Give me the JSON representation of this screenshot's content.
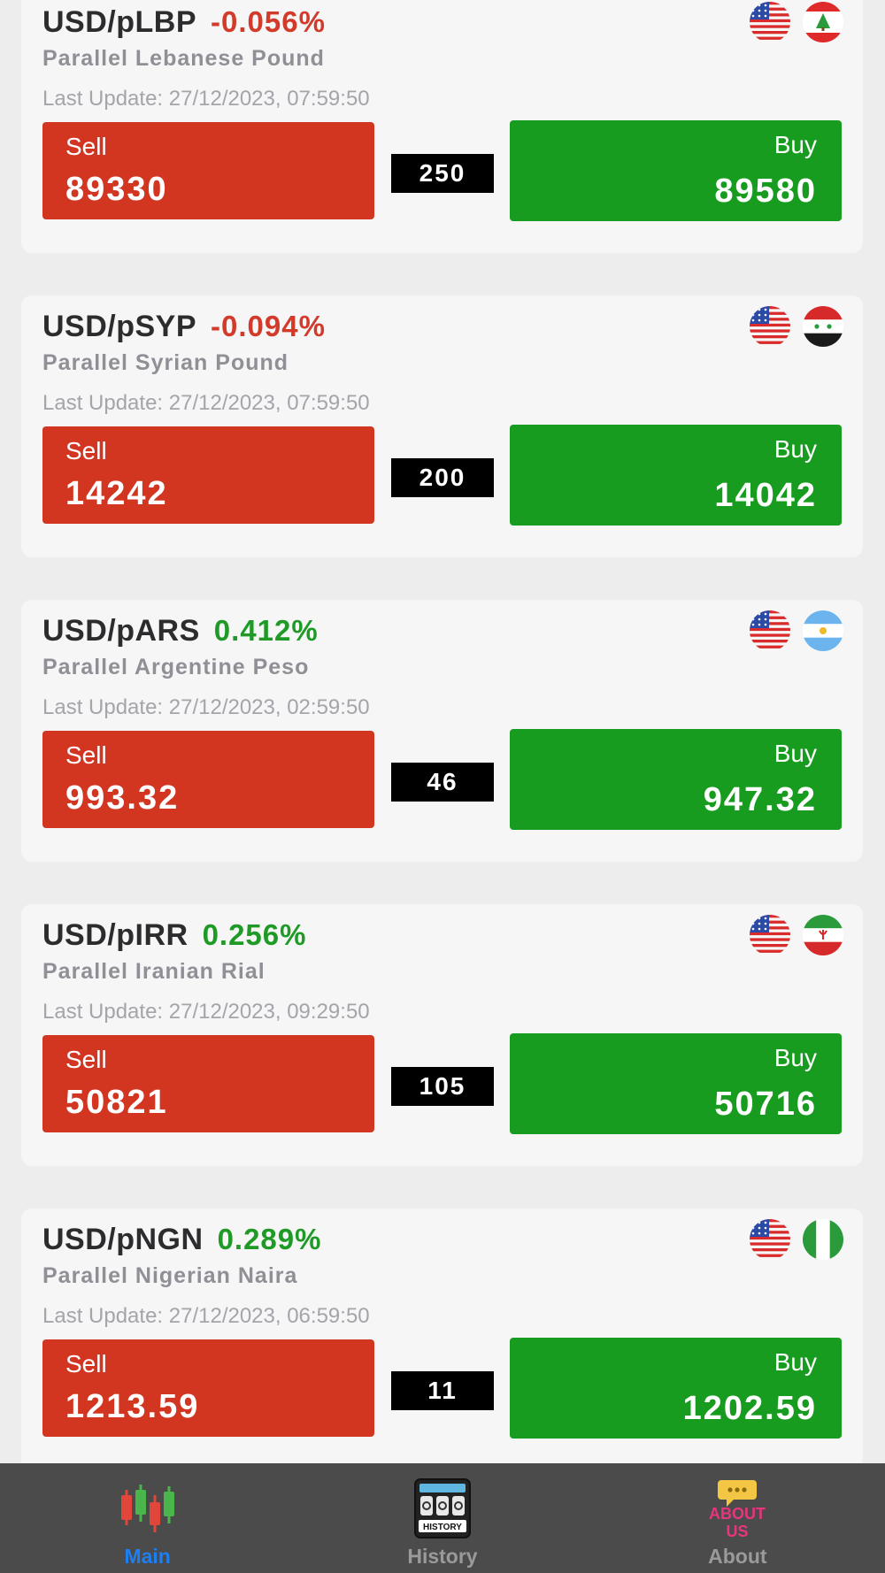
{
  "cards": [
    {
      "pair": "USD/pLBP",
      "change": "-0.056%",
      "trend": "neg",
      "name": "Parallel Lebanese Pound",
      "updated": "Last Update: 27/12/2023, 07:59:50",
      "sell_label": "Sell",
      "sell": "89330",
      "spread": "250",
      "buy_label": "Buy",
      "buy": "89580",
      "flags": [
        "us-flag-icon",
        "lebanon-flag-icon"
      ]
    },
    {
      "pair": "USD/pSYP",
      "change": "-0.094%",
      "trend": "neg",
      "name": "Parallel Syrian Pound",
      "updated": "Last Update: 27/12/2023, 07:59:50",
      "sell_label": "Sell",
      "sell": "14242",
      "spread": "200",
      "buy_label": "Buy",
      "buy": "14042",
      "flags": [
        "us-flag-icon",
        "syria-flag-icon"
      ]
    },
    {
      "pair": "USD/pARS",
      "change": "0.412%",
      "trend": "pos",
      "name": "Parallel Argentine Peso",
      "updated": "Last Update: 27/12/2023, 02:59:50",
      "sell_label": "Sell",
      "sell": "993.32",
      "spread": "46",
      "buy_label": "Buy",
      "buy": "947.32",
      "flags": [
        "us-flag-icon",
        "argentina-flag-icon"
      ]
    },
    {
      "pair": "USD/pIRR",
      "change": "0.256%",
      "trend": "pos",
      "name": "Parallel Iranian Rial",
      "updated": "Last Update: 27/12/2023, 09:29:50",
      "sell_label": "Sell",
      "sell": "50821",
      "spread": "105",
      "buy_label": "Buy",
      "buy": "50716",
      "flags": [
        "us-flag-icon",
        "iran-flag-icon"
      ]
    },
    {
      "pair": "USD/pNGN",
      "change": "0.289%",
      "trend": "pos",
      "name": "Parallel Nigerian Naira",
      "updated": "Last Update: 27/12/2023, 06:59:50",
      "sell_label": "Sell",
      "sell": "1213.59",
      "spread": "11",
      "buy_label": "Buy",
      "buy": "1202.59",
      "flags": [
        "us-flag-icon",
        "nigeria-flag-icon"
      ]
    }
  ],
  "tabbar": {
    "tabs": [
      {
        "label": "Main",
        "icon": "candlestick-chart-icon",
        "active": true
      },
      {
        "label": "History",
        "icon": "history-counter-icon",
        "active": false
      },
      {
        "label": "About",
        "icon": "about-us-icon",
        "active": false
      }
    ],
    "about_icon_text_1": "ABOUT",
    "about_icon_text_2": "US",
    "history_icon_text": "HISTORY",
    "active_color": "#1d7ff0"
  },
  "colors": {
    "sell": "#d23520",
    "buy": "#179c1f",
    "negative": "#d23a2a",
    "positive": "#1f9a27",
    "spread": "#000000"
  }
}
